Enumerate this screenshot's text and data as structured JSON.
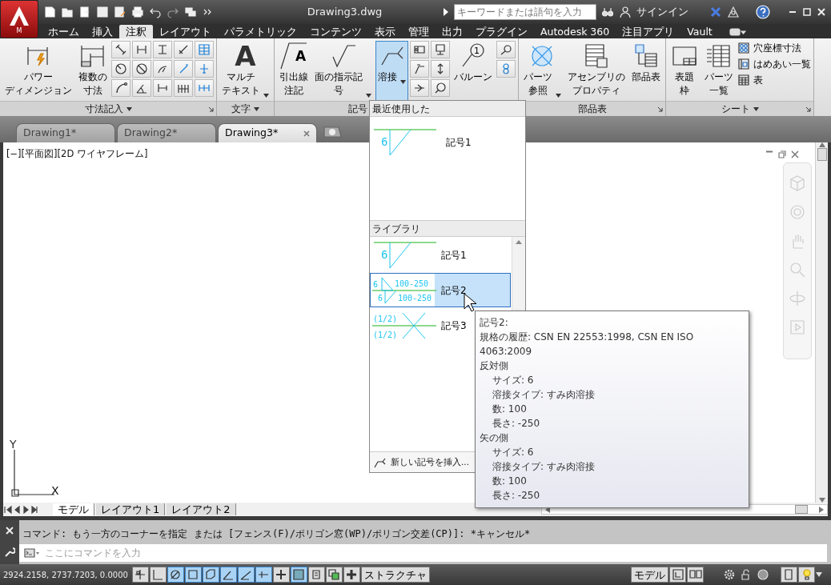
{
  "app_button": {
    "label": "M"
  },
  "title_bar": {
    "title": "Drawing3.dwg",
    "search": {
      "placeholder": "キーワードまたは語句を入力"
    },
    "sign_in": "サインイン"
  },
  "ribbon_tabs": [
    {
      "label": "ホーム",
      "selected": false
    },
    {
      "label": "挿入",
      "selected": false
    },
    {
      "label": "注釈",
      "selected": true
    },
    {
      "label": "レイアウト",
      "selected": false
    },
    {
      "label": "パラメトリック",
      "selected": false
    },
    {
      "label": "コンテンツ",
      "selected": false
    },
    {
      "label": "表示",
      "selected": false
    },
    {
      "label": "管理",
      "selected": false
    },
    {
      "label": "出力",
      "selected": false
    },
    {
      "label": "プラグイン",
      "selected": false
    },
    {
      "label": "Autodesk 360",
      "selected": false
    },
    {
      "label": "注目アプリ",
      "selected": false
    },
    {
      "label": "Vault",
      "selected": false
    }
  ],
  "ribbon_panels": [
    {
      "title": "寸法記入",
      "menu": true,
      "launcher": true,
      "items": [
        {
          "kind": "large",
          "label": [
            "パワー",
            "ディメンジョン"
          ],
          "selected": false
        },
        {
          "kind": "large",
          "label": [
            "複数の",
            "寸法"
          ],
          "selected": false
        },
        {
          "kind": "dim-grid"
        },
        {
          "kind": "dim-column"
        }
      ]
    },
    {
      "title": "文字",
      "menu": true,
      "items": [
        {
          "kind": "large",
          "icon_text": "A",
          "label": [
            "マルチ",
            "テキスト"
          ],
          "dropdown": true,
          "selected": false
        }
      ]
    },
    {
      "title": "記号",
      "items": [
        {
          "kind": "large",
          "icon_text": "A",
          "label": [
            "引出線",
            "注記"
          ],
          "selected": false
        },
        {
          "kind": "large",
          "label": [
            "面の指示記",
            "号"
          ],
          "dropdown": true,
          "selected": false
        },
        {
          "kind": "large",
          "label": [
            "溶接"
          ],
          "dropdown": true,
          "selected": true
        },
        {
          "kind": "symbol-grid"
        },
        {
          "kind": "large",
          "icon_text": "1",
          "label": [
            "バルーン"
          ],
          "selected": false
        },
        {
          "kind": "balloon-column"
        }
      ]
    },
    {
      "title": "部品表",
      "launcher": true,
      "items": [
        {
          "kind": "large",
          "label": [
            "パーツ",
            "参照"
          ],
          "dropdown": true,
          "selected": false
        },
        {
          "kind": "large",
          "label": [
            "アセンブリの",
            "プロパティ"
          ],
          "selected": false
        },
        {
          "kind": "large",
          "label": [
            "部品表"
          ],
          "selected": false
        }
      ]
    },
    {
      "title": "シート",
      "menu": true,
      "launcher": true,
      "items": [
        {
          "kind": "large",
          "label": [
            "表題",
            "枠"
          ],
          "selected": false
        },
        {
          "kind": "large",
          "label": [
            "パーツ",
            "一覧"
          ],
          "selected": false
        },
        {
          "kind": "small-list",
          "entries": [
            {
              "label": "穴座標寸法"
            },
            {
              "label": "はめあい一覧"
            },
            {
              "label": "表"
            }
          ]
        }
      ]
    }
  ],
  "doc_tabs": [
    {
      "label": "Drawing1*",
      "selected": false
    },
    {
      "label": "Drawing2*",
      "selected": false
    },
    {
      "label": "Drawing3*",
      "selected": true
    }
  ],
  "viewport": {
    "label": "[−][平面図][2D ワイヤフレーム]"
  },
  "ucs": {
    "x": "X",
    "y": "Y"
  },
  "layout_tabs": [
    {
      "label": "モデル",
      "selected": true
    },
    {
      "label": "レイアウト1",
      "selected": false
    },
    {
      "label": "レイアウト2",
      "selected": false
    }
  ],
  "command_line": {
    "history": "コマンド: もう一方のコーナーを指定 または [フェンス(F)/ポリゴン窓(WP)/ポリゴン交差(CP)]: *キャンセル*",
    "placeholder": "ここにコマンドを入力"
  },
  "status_bar": {
    "coordinates": "2924.2158, 2737.7203, 0.0000",
    "toggles": [
      {
        "on": false
      },
      {
        "on": false
      },
      {
        "on": true
      },
      {
        "on": true
      },
      {
        "on": true
      },
      {
        "on": true
      },
      {
        "on": true
      },
      {
        "on": true
      },
      {
        "on": false
      },
      {
        "on": true
      },
      {
        "on": false
      },
      {
        "on": false
      },
      {
        "on": false
      }
    ],
    "structure": "ストラクチャ",
    "model": "モデル"
  },
  "weld_dropdown": {
    "recent_header": "最近使用した",
    "recent": [
      {
        "label": "記号1",
        "preview": {
          "kind": "fillet",
          "texts": [
            "6"
          ]
        }
      }
    ],
    "library_header": "ライブラリ",
    "library": [
      {
        "label": "記号1",
        "selected": false,
        "preview": {
          "kind": "fillet",
          "texts": [
            "6"
          ]
        }
      },
      {
        "label": "記号2",
        "selected": true,
        "preview": {
          "kind": "fillet-both",
          "texts": [
            "6",
            "100-250",
            "6",
            "100-250"
          ]
        }
      },
      {
        "label": "記号3",
        "selected": false,
        "preview": {
          "kind": "cross",
          "texts": [
            "(1/2)",
            "(1/2)"
          ]
        }
      }
    ],
    "insert_label": "新しい記号を挿入..."
  },
  "tooltip": {
    "title": "記号2:",
    "lines": [
      {
        "text": "規格の履歴: CSN EN 22553:1998, CSN EN ISO 4063:2009"
      },
      {
        "text": "反対側",
        "children": [
          {
            "text": "サイズ: 6"
          },
          {
            "text": "溶接タイプ: すみ肉溶接"
          },
          {
            "text": "数: 100"
          },
          {
            "text": "長さ: -250"
          }
        ]
      },
      {
        "text": "矢の側",
        "children": [
          {
            "text": "サイズ: 6"
          },
          {
            "text": "溶接タイプ: すみ肉溶接"
          },
          {
            "text": "数: 100"
          },
          {
            "text": "長さ: -250"
          }
        ]
      }
    ]
  }
}
